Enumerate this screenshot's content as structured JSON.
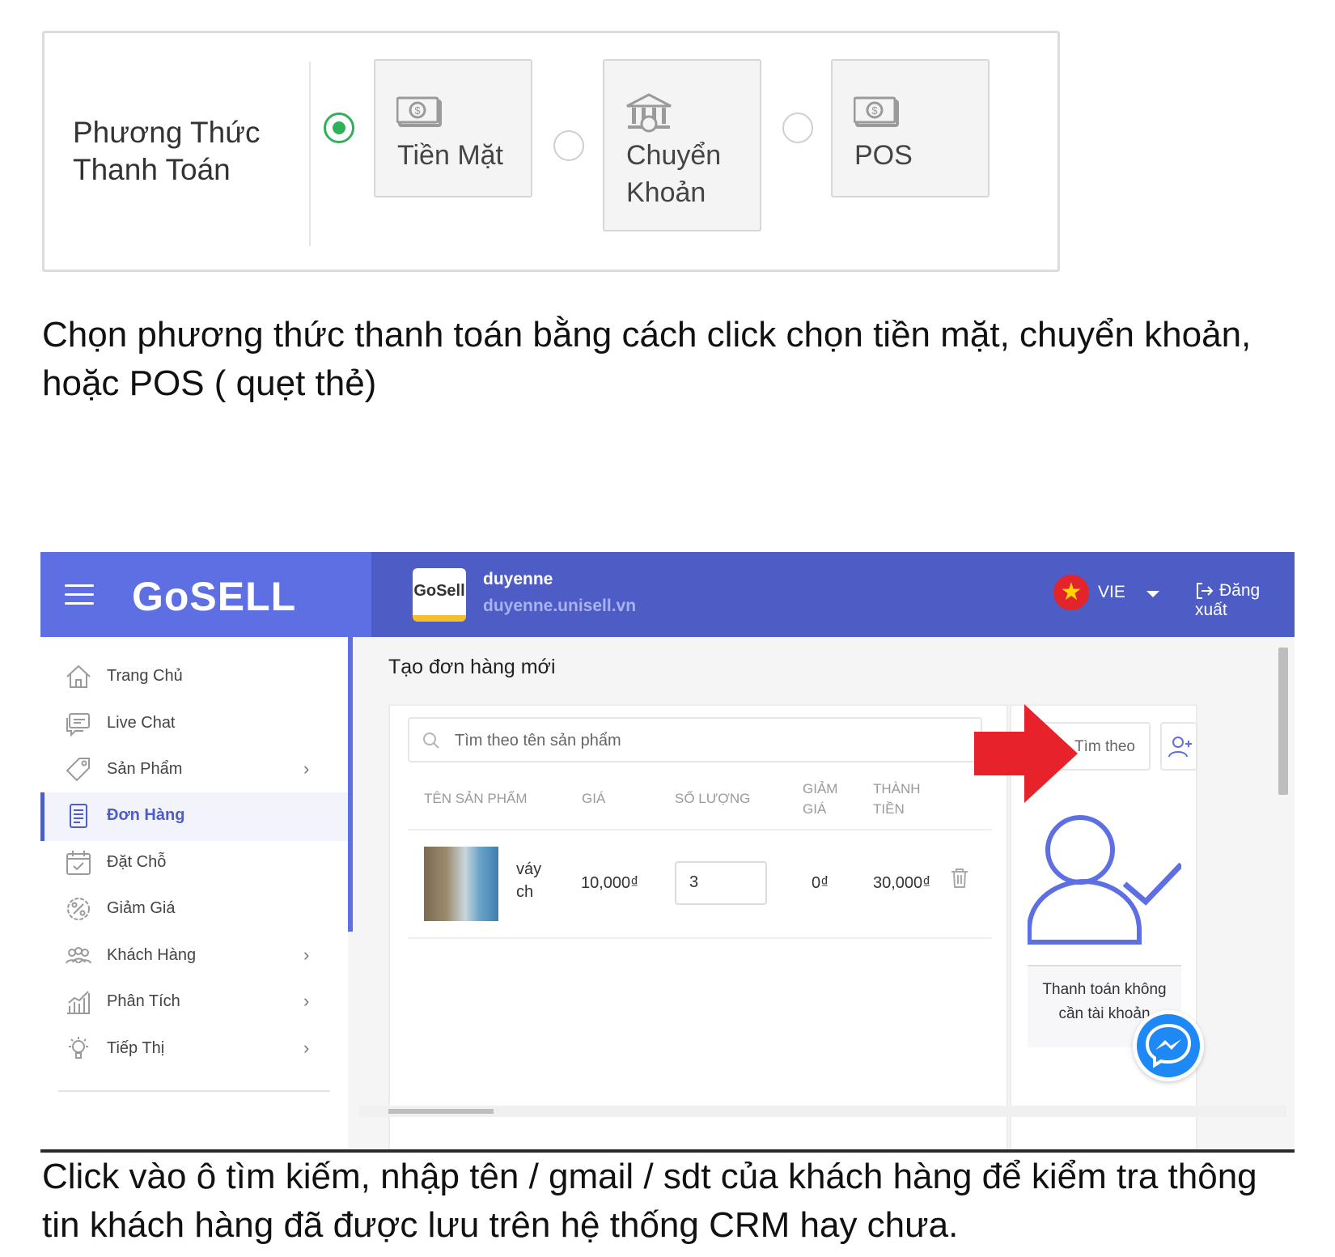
{
  "payment_section": {
    "title_line1": "Phương Thức",
    "title_line2": "Thanh Toán",
    "options": [
      {
        "label": "Tiền Mặt",
        "selected": true,
        "icon": "cash-icon"
      },
      {
        "label": "Chuyển Khoản",
        "label_line1": "Chuyển",
        "label_line2": "Khoản",
        "selected": false,
        "icon": "bank-icon"
      },
      {
        "label": "POS",
        "selected": false,
        "icon": "pos-icon"
      }
    ]
  },
  "caption_top": "Chọn phương thức thanh toán bằng cách click chọn tiền mặt, chuyển khoản, hoặc POS ( quẹt thẻ)",
  "app": {
    "logo": "GoSELL",
    "shop_logo_text": "GoSell",
    "shop_name": "duyenne",
    "shop_url": "duyenne.unisell.vn",
    "language": "VIE",
    "logout_label": "Đăng xuất",
    "sidebar": [
      {
        "label": "Trang Chủ",
        "icon": "home-icon",
        "has_children": false,
        "active": false
      },
      {
        "label": "Live Chat",
        "icon": "chat-icon",
        "has_children": false,
        "active": false
      },
      {
        "label": "Sản Phẩm",
        "icon": "tag-icon",
        "has_children": true,
        "active": false
      },
      {
        "label": "Đơn Hàng",
        "icon": "order-icon",
        "has_children": false,
        "active": true
      },
      {
        "label": "Đặt Chỗ",
        "icon": "calendar-icon",
        "has_children": false,
        "active": false
      },
      {
        "label": "Giảm Giá",
        "icon": "discount-icon",
        "has_children": false,
        "active": false
      },
      {
        "label": "Khách Hàng",
        "icon": "customers-icon",
        "has_children": true,
        "active": false
      },
      {
        "label": "Phân Tích",
        "icon": "analytics-icon",
        "has_children": true,
        "active": false
      },
      {
        "label": "Tiếp Thị",
        "icon": "marketing-icon",
        "has_children": true,
        "active": false
      }
    ],
    "page_title": "Tạo đơn hàng mới",
    "product_search_placeholder": "Tìm theo tên sản phẩm",
    "table_headers": {
      "name": "TÊN SẢN PHẨM",
      "price": "GIÁ",
      "qty": "SỐ LƯỢNG",
      "discount_line1": "GIẢM",
      "discount_line2": "GIÁ",
      "total_line1": "THÀNH",
      "total_line2": "TIỀN"
    },
    "order_rows": [
      {
        "name_line1": "váy",
        "name_line2": "ch",
        "price": "10,000₫",
        "qty": "3",
        "discount": "0₫",
        "total": "30,000₫"
      }
    ],
    "customer_search_placeholder": "Tìm theo",
    "guest_text_line1": "Thanh toán không",
    "guest_text_line2": "cần tài khoản"
  },
  "caption_bottom": "Click vào ô tìm kiếm, nhập tên / gmail / sdt của khách hàng để kiểm tra thông tin khách hàng đã được lưu trên hệ thống CRM hay chưa.",
  "colors": {
    "accent": "#4e5cc6",
    "topbar_left": "#5d6fe2",
    "selected_radio": "#2fb15a",
    "arrow": "#e8222a",
    "messenger": "#1e88f5"
  }
}
